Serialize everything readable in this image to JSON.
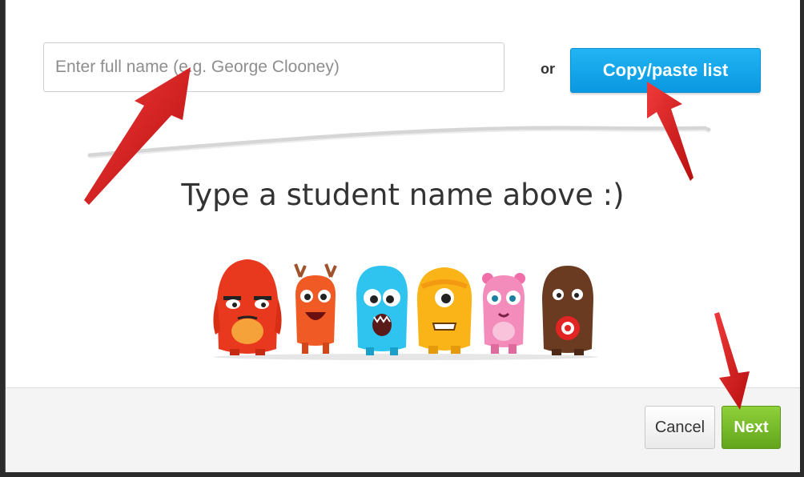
{
  "form": {
    "name_input_placeholder": "Enter full name (e.g. George Clooney)",
    "or_label": "or",
    "copy_paste_label": "Copy/paste list"
  },
  "hint_text": "Type a student name above :)",
  "footer": {
    "cancel_label": "Cancel",
    "next_label": "Next"
  },
  "colors": {
    "primary_blue": "#0a98e0",
    "next_green": "#6cb52a",
    "annotation_red": "#d81e1e"
  },
  "icons": {
    "monsters": "monster-group-illustration",
    "annotation": "red-arrow-annotation"
  }
}
